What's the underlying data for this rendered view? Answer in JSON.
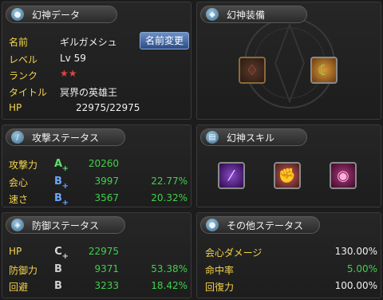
{
  "data_panel": {
    "title": "幻神データ",
    "fields": [
      {
        "label": "名前",
        "value": "ギルガメシュ"
      },
      {
        "label": "レベル",
        "value": "Lv 59"
      },
      {
        "label": "ランク",
        "value": "★★"
      },
      {
        "label": "タイトル",
        "value": "冥界の英雄王"
      },
      {
        "label": "HP",
        "value": "22975/22975"
      }
    ],
    "rename_button": "名前変更"
  },
  "equip_panel": {
    "title": "幻神装備"
  },
  "attack_panel": {
    "title": "攻撃ステータス",
    "rows": [
      {
        "label": "攻撃力",
        "rank": "A",
        "value": "20260",
        "percent": ""
      },
      {
        "label": "会心",
        "rank": "B",
        "value": "3997",
        "percent": "22.77%"
      },
      {
        "label": "速さ",
        "rank": "B",
        "value": "3567",
        "percent": "20.32%"
      }
    ]
  },
  "skill_panel": {
    "title": "幻神スキル"
  },
  "defense_panel": {
    "title": "防御ステータス",
    "rows": [
      {
        "label": "HP",
        "rank": "C",
        "value": "22975",
        "percent": ""
      },
      {
        "label": "防御力",
        "rank": "B",
        "value": "9371",
        "percent": "53.38%"
      },
      {
        "label": "回避",
        "rank": "B",
        "value": "3233",
        "percent": "18.42%"
      }
    ]
  },
  "other_panel": {
    "title": "その他ステータス",
    "rows": [
      {
        "label": "会心ダメージ",
        "value": "130.00%"
      },
      {
        "label": "命中率",
        "value": "5.00%"
      },
      {
        "label": "回復力",
        "value": "100.00%"
      }
    ]
  },
  "colors": {
    "label": "#f4d44c",
    "positive": "#3fd14a",
    "rank_A": "#5de06a",
    "rank_B": "#6aa6ff"
  }
}
